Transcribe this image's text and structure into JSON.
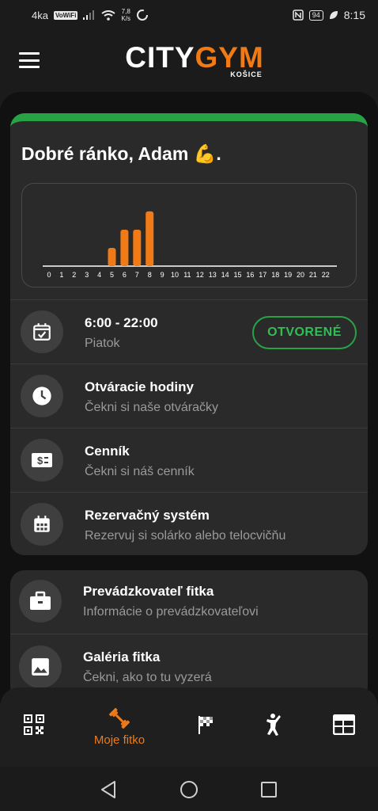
{
  "status_bar": {
    "carrier": "4ka",
    "vowifi": "VoWiFi",
    "speed_value": "7,8",
    "speed_unit": "K/s",
    "battery": "94",
    "time": "8:15"
  },
  "header": {
    "logo_white": "CITY",
    "logo_orange": "GYM",
    "logo_city": "KOŠICE",
    "accent_color": "#f07a16"
  },
  "greeting": "Dobré ránko, Adam 💪.",
  "chart_data": {
    "type": "bar",
    "categories": [
      "0",
      "1",
      "2",
      "3",
      "4",
      "5",
      "6",
      "7",
      "8",
      "9",
      "10",
      "11",
      "12",
      "13",
      "14",
      "15",
      "16",
      "17",
      "18",
      "19",
      "20",
      "21",
      "22"
    ],
    "values": [
      0,
      0,
      0,
      0,
      0,
      1,
      2,
      2,
      3,
      0,
      0,
      0,
      0,
      0,
      0,
      0,
      0,
      0,
      0,
      0,
      0,
      0,
      0
    ],
    "ylim": [
      0,
      3.3
    ],
    "bar_color": "#f07a16",
    "grid": false,
    "title": "",
    "xlabel": "",
    "ylabel": ""
  },
  "hours": {
    "time": "6:00 - 22:00",
    "day": "Piatok",
    "status": "OTVORENÉ",
    "status_color": "#27a346"
  },
  "menu_rows": [
    {
      "title": "Otváracie hodiny",
      "subtitle": "Čekni si naše otváračky",
      "icon": "clock-icon"
    },
    {
      "title": "Cenník",
      "subtitle": "Čekni si náš cenník",
      "icon": "price-icon"
    },
    {
      "title": "Rezervačný systém",
      "subtitle": "Rezervuj si solárko alebo telocvičňu",
      "icon": "calendar-icon"
    }
  ],
  "menu_rows_2": [
    {
      "title": "Prevádzkovateľ fitka",
      "subtitle": "Informácie o prevádzkovateľovi",
      "icon": "briefcase-icon"
    },
    {
      "title": "Galéria fitka",
      "subtitle": "Čekni, ako to tu vyzerá",
      "icon": "image-icon"
    }
  ],
  "bottom_nav": {
    "active_label": "Moje fitko",
    "items": [
      "qr-code-icon",
      "dumbbell-icon",
      "checkered-flag-icon",
      "karate-icon",
      "schedule-icon"
    ]
  }
}
